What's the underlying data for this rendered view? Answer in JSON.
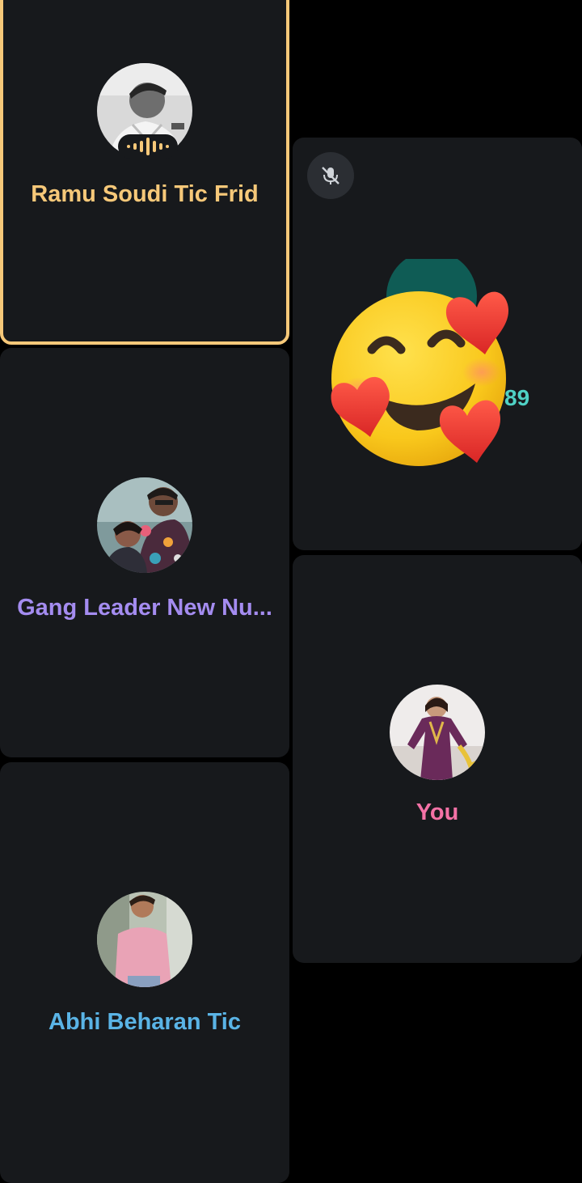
{
  "participants": [
    {
      "name": "Ramu Soudi Tic Frid",
      "color": "#f6c879",
      "status": "speaking",
      "avatar": "man-portrait-bw"
    },
    {
      "name": "Gang Leader New Nu...",
      "color": "#a48cf0",
      "avatar": "couple-photo"
    },
    {
      "name": "Abhi Beharan Tic",
      "color": "#5ab4e6",
      "avatar": "man-pink-shirt"
    },
    {
      "peek_text": "89",
      "peek_color": "#4fd1c5",
      "mic": "mic-off-icon",
      "reaction": "smiling-face-with-hearts-emoji"
    },
    {
      "name": "You",
      "color": "#f472a6",
      "avatar": "woman-purple-dress"
    }
  ],
  "colors": {
    "background": "#000000",
    "tile": "#17191c",
    "active_border": "#f6c879"
  }
}
